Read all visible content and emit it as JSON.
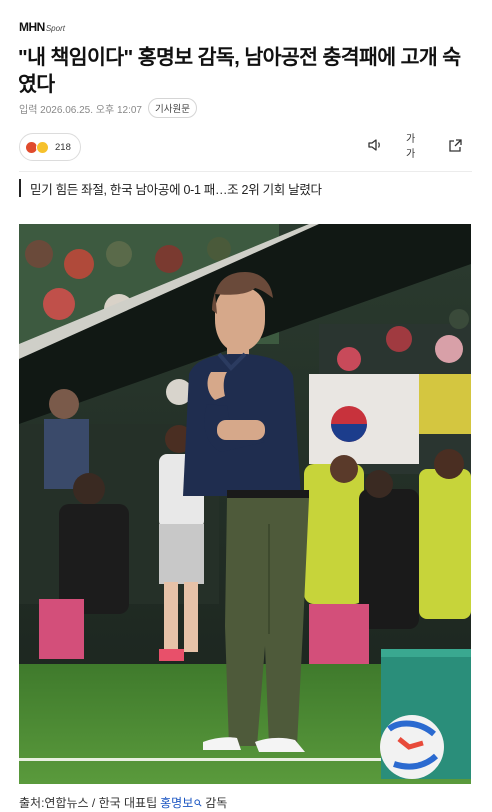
{
  "header": {
    "logo_main": "MHN",
    "logo_sub": "Sport"
  },
  "article": {
    "title": "\"내 책임이다\" 홍명보 감독, 남아공전 충격패에 고개 숙였다",
    "date": "입력 2026.06.25. 오후 12:07",
    "original_label": "기사원문",
    "reaction_count": "218",
    "font_tool_label": "가가",
    "subtitle": "믿기 힘든 좌절, 한국 남아공에 0-1 패…조 2위 기회 날렸다",
    "caption_prefix": "출처:연합뉴스 / 한국 대표팁",
    "caption_link": "홍명보",
    "caption_suffix": "감독"
  },
  "icons": [
    "angry-emoji-icon",
    "laugh-emoji-icon",
    "audio-icon",
    "font-size-icon",
    "share-icon",
    "search-link-icon"
  ],
  "colors": {
    "link": "#1a55c2",
    "jersey": "#1f2d4f",
    "pants": "#4e5a3a",
    "pitch": "#4f8c36"
  }
}
